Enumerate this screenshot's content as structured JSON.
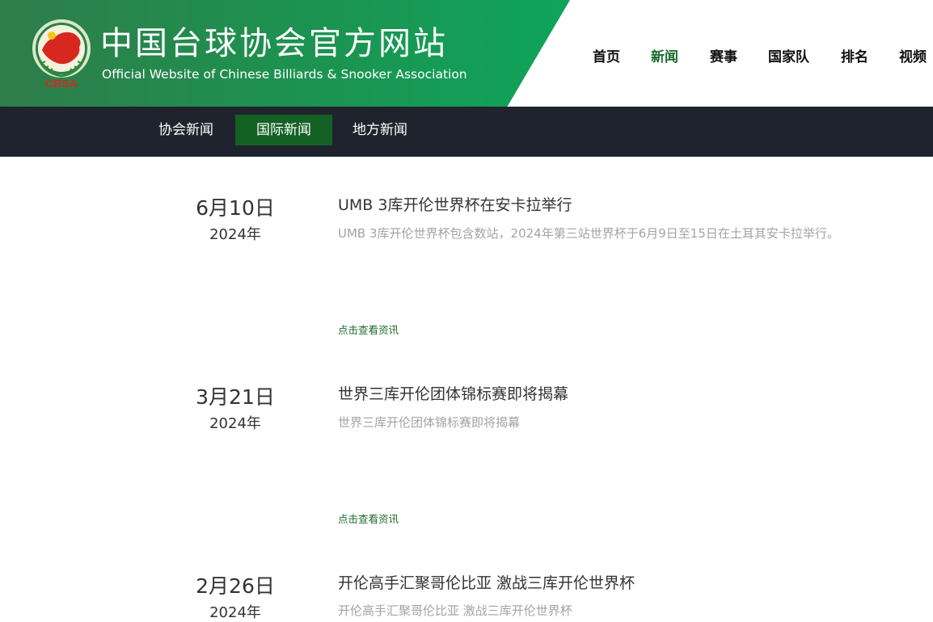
{
  "header": {
    "title_cn": "中国台球协会官方网站",
    "title_en": "Official Website of Chinese Billiards & Snooker Association",
    "logo_text": "CBSA"
  },
  "top_nav": [
    {
      "label": "首页",
      "active": false
    },
    {
      "label": "新闻",
      "active": true
    },
    {
      "label": "赛事",
      "active": false
    },
    {
      "label": "国家队",
      "active": false
    },
    {
      "label": "排名",
      "active": false
    },
    {
      "label": "视频",
      "active": false
    }
  ],
  "sub_nav": [
    {
      "label": "协会新闻",
      "active": false
    },
    {
      "label": "国际新闻",
      "active": true
    },
    {
      "label": "地方新闻",
      "active": false
    }
  ],
  "news": [
    {
      "day": "6月10日",
      "year": "2024年",
      "title": "UMB 3库开伦世界杯在安卡拉举行",
      "desc": "UMB 3库开伦世界杯包含数站，2024年第三站世界杯于6月9日至15日在土耳其安卡拉举行。",
      "link": "点击查看资讯"
    },
    {
      "day": "3月21日",
      "year": "2024年",
      "title": "世界三库开伦团体锦标赛即将揭幕",
      "desc": "世界三库开伦团体锦标赛即将揭幕",
      "link": "点击查看资讯"
    },
    {
      "day": "2月26日",
      "year": "2024年",
      "title": "开伦高手汇聚哥伦比亚 激战三库开伦世界杯",
      "desc": "开伦高手汇聚哥伦比亚 激战三库开伦世界杯",
      "link": ""
    }
  ],
  "colors": {
    "banner_green": "#0fa45a",
    "nav_active": "#1b6b2d",
    "subnav_bg": "#1f232d",
    "subnav_active": "#146124"
  }
}
